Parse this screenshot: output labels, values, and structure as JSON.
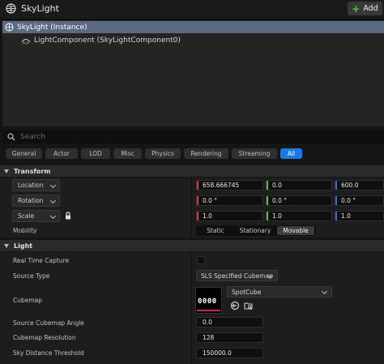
{
  "header": {
    "title": "SkyLight",
    "add_label": "Add",
    "title_icon": "skylight-icon",
    "add_icon": "plus-icon"
  },
  "tree": {
    "selected": {
      "label": "SkyLight (Instance)",
      "icon": "actor-icon"
    },
    "child": {
      "label": "LightComponent (SkyLightComponent0)",
      "icon": "skylight-component-icon"
    }
  },
  "search": {
    "placeholder": "Search",
    "icon": "search-icon"
  },
  "filters": [
    "General",
    "Actor",
    "LOD",
    "Misc",
    "Physics",
    "Rendering",
    "Streaming",
    "All"
  ],
  "active_filter": "All",
  "transform": {
    "header": "Transform",
    "location": {
      "label": "Location",
      "x": "658.666745",
      "y": "0.0",
      "z": "600.0"
    },
    "rotation": {
      "label": "Rotation",
      "x": "0.0 °",
      "y": "0.0 °",
      "z": "0.0 °"
    },
    "scale": {
      "label": "Scale",
      "x": "1.0",
      "y": "1.0",
      "z": "1.0",
      "lock_icon": "lock-icon"
    },
    "mobility": {
      "label": "Mobility",
      "options": [
        "Static",
        "Stationary",
        "Movable"
      ],
      "selected": "Movable"
    }
  },
  "light": {
    "header": "Light",
    "real_time_capture": {
      "label": "Real Time Capture",
      "checked": false
    },
    "source_type": {
      "label": "Source Type",
      "value": "SLS Specified Cubemap"
    },
    "cubemap": {
      "label": "Cubemap",
      "value": "SpotCube",
      "thumb_text": "0000",
      "icons": [
        "use-selected-icon",
        "browse-asset-icon"
      ]
    },
    "source_cubemap_angle": {
      "label": "Source Cubemap Angle",
      "value": "0.0"
    },
    "cubemap_resolution": {
      "label": "Cubemap Resolution",
      "value": "128"
    },
    "sky_distance_threshold": {
      "label": "Sky Distance Threshold",
      "value": "150000.0"
    }
  },
  "colors": {
    "x_axis": "#d33a3a",
    "y_axis": "#6fba2c",
    "z_axis": "#2f6fd6",
    "accent": "#1a78e0",
    "selection": "#5a6a80"
  }
}
